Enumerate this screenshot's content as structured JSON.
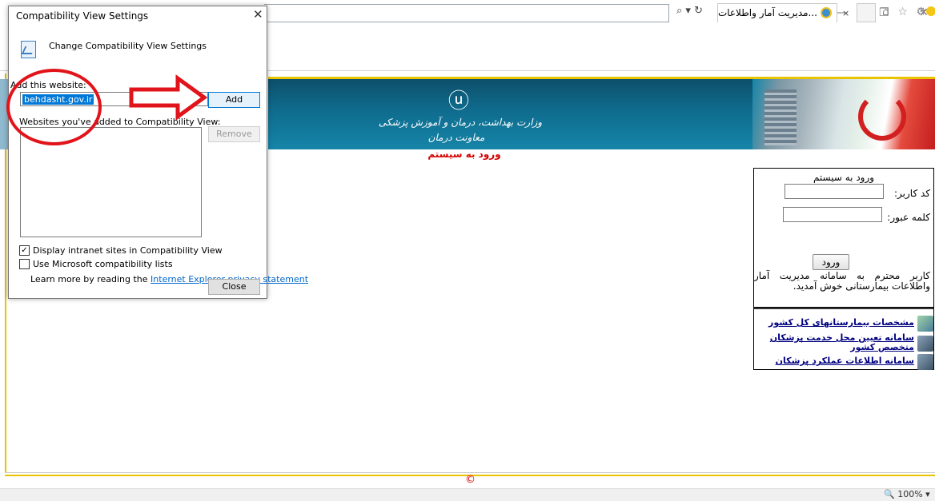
{
  "browser": {
    "tab_title": "...مدیریت آمار واطلاعات بیمار",
    "tab_close": "×",
    "window_minimize": "—",
    "window_restore": "❐",
    "window_close": "✕",
    "search_glyph": "⌕ ▾ ↻",
    "toolbar_glyphs": "⌂ ☆ ⚙",
    "zoom": "🔍 100% ▾",
    "icons": [
      "search-icon",
      "refresh-icon",
      "home-icon",
      "favorites-icon",
      "settings-icon",
      "feedback-smiley-icon",
      "ie-logo-icon"
    ]
  },
  "dialog": {
    "title": "Compatibility View Settings",
    "close_glyph": "✕",
    "heading": "Change Compatibility View Settings",
    "add_label": "Add this website:",
    "website_value": "behdasht.gov.ir",
    "add_button": "Add",
    "list_label": "Websites you've added to Compatibility View:",
    "remove_button": "Remove",
    "checkboxes": [
      {
        "label": "Display intranet sites in Compatibility View",
        "checked": true,
        "glyph": "✓"
      },
      {
        "label": "Use Microsoft compatibility lists",
        "checked": false,
        "glyph": ""
      }
    ],
    "learn_more_text": "Learn more by reading the ",
    "learn_more_link": "Internet Explorer privacy statement",
    "close_button": "Close"
  },
  "page": {
    "emblem_glyph": "ⓤ",
    "banner_line1": "وزارت بهداشت، درمان و آموزش پزشکی",
    "banner_line2": "معاونت درمان",
    "login_heading": "ورود به سیستم",
    "login_box": {
      "title": "ورود به سیستم",
      "user_code_label": "کد کاربر:",
      "password_label": "کلمه عبور:",
      "submit_button": "ورود",
      "welcome_text": "کاربر محترم به سامانه مدیریت آمار واطلاعات بیمارستانی خوش آمدید."
    },
    "links": [
      "مشخصات بیمارستانهای کل کشور",
      "سامانه تعیین محل خدمت پزشکان متخصص کشور",
      "سامانه اطلاعات عملکرد پزشکان"
    ],
    "copyright_glyph": "©"
  },
  "colors": {
    "annotation": "#e1141b",
    "banner": "#0f6c8e",
    "page_accent": "#e9c400",
    "link": "#000080"
  }
}
